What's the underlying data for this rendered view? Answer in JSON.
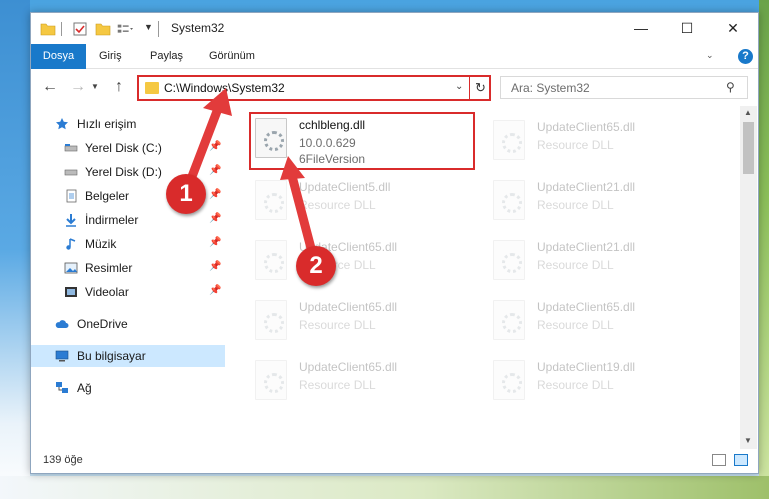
{
  "window": {
    "title": "System32",
    "controls": {
      "minimize": "—",
      "maximize": "☐",
      "close": "✕"
    }
  },
  "ribbon": {
    "tabs": [
      "Dosya",
      "Giriş",
      "Paylaş",
      "Görünüm"
    ],
    "help": "?"
  },
  "navigation": {
    "address": "C:\\Windows\\System32",
    "search_placeholder": "Ara: System32"
  },
  "sidebar": {
    "quick_access": "Hızlı erişim",
    "pinned": [
      "Yerel Disk (C:)",
      "Yerel Disk (D:)",
      "Belgeler",
      "İndirmeler",
      "Müzik",
      "Resimler",
      "Videolar"
    ],
    "onedrive": "OneDrive",
    "this_pc": "Bu bilgisayar",
    "network": "Ağ"
  },
  "files": [
    {
      "name": "cchlbleng.dll",
      "line2": "10.0.0.629",
      "line3": "6FileVersion",
      "highlighted": true
    },
    {
      "name": "UpdateClient65.dll",
      "line2": "Resource DLL"
    },
    {
      "name": "UpdateClient5.dll",
      "line2": "Resource DLL"
    },
    {
      "name": "UpdateClient21.dll",
      "line2": "Resource DLL"
    },
    {
      "name": "UpdateClient65.dll",
      "line2": "Resource DLL"
    },
    {
      "name": "UpdateClient21.dll",
      "line2": "Resource DLL"
    },
    {
      "name": "UpdateClient65.dll",
      "line2": "Resource DLL"
    },
    {
      "name": "UpdateClient65.dll",
      "line2": "Resource DLL"
    },
    {
      "name": "UpdateClient65.dll",
      "line2": "Resource DLL"
    },
    {
      "name": "UpdateClient19.dll",
      "line2": "Resource DLL"
    }
  ],
  "status": {
    "item_count": "139 öğe"
  },
  "annotations": {
    "badge1": "1",
    "badge2": "2"
  },
  "colors": {
    "accent": "#1979ca",
    "highlight": "#d92b2b",
    "selected": "#cce8ff"
  }
}
